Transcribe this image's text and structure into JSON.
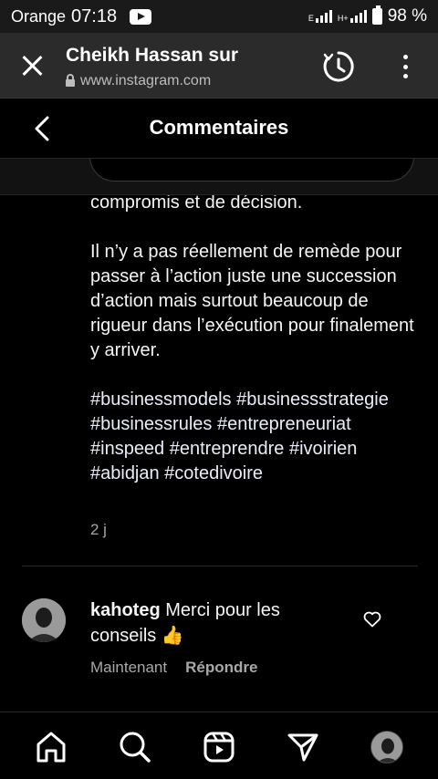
{
  "status_bar": {
    "carrier": "Orange",
    "time": "07:18",
    "network_label": "E",
    "network_label_2": "H+",
    "battery": "98 %"
  },
  "browser": {
    "title": "Cheikh Hassan sur",
    "url": "www.instagram.com"
  },
  "header": {
    "title": "Commentaires"
  },
  "caption": {
    "lines": [
      "compromis et de décision.",
      "Il n’y a pas réellement de remède pour passer à l’action juste une succession d’action mais surtout beaucoup de rigueur dans l’exécution pour finalement y arriver.",
      "#businessmodels #businessstrategie #businessrules #entrepreneuriat #inspeed #entreprendre #ivoirien #abidjan #cotedivoire"
    ],
    "time": "2 j"
  },
  "comment": {
    "username": "kahoteg",
    "text": "Merci pour les conseils 👍",
    "time": "Maintenant",
    "reply_label": "Répondre"
  },
  "nav": {
    "items": [
      "home-icon",
      "search-icon",
      "reels-icon",
      "direct-icon",
      "profile-avatar"
    ]
  },
  "colors": {
    "background": "#000000",
    "browser_bar": "#2b2b2b",
    "secondary_text": "#a8a8a8"
  }
}
